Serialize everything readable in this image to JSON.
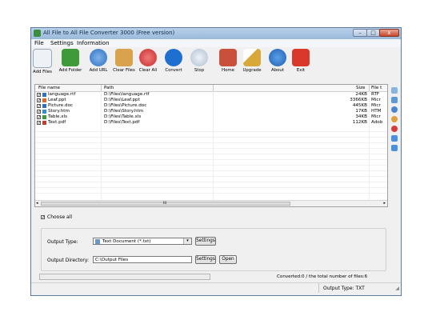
{
  "window": {
    "title": "All File to All File Converter 3000 (Free version)"
  },
  "menu": [
    "File",
    "Settings",
    "Information"
  ],
  "toolbar": [
    {
      "label": "Add Files",
      "icon": "add-files-icon",
      "color": "#e8eef4"
    },
    {
      "label": "Add Folder",
      "icon": "add-folder-icon",
      "color": "#3f9a3a"
    },
    {
      "label": "Add URL",
      "icon": "globe-icon",
      "color": "#2f6fc4"
    },
    {
      "label": "Clear Files",
      "icon": "clear-files-icon",
      "color": "#d9a24c"
    },
    {
      "label": "Clear All",
      "icon": "clear-all-icon",
      "color": "#d93a3a"
    },
    {
      "label": "Convert",
      "icon": "convert-icon",
      "color": "#1f6fd0"
    },
    {
      "label": "Stop",
      "icon": "stop-icon",
      "color": "#b9c9d9"
    },
    {
      "label": "Home",
      "icon": "home-icon",
      "color": "#c9503a"
    },
    {
      "label": "Upgrade",
      "icon": "upgrade-wand-icon",
      "color": "#d9a83a"
    },
    {
      "label": "About",
      "icon": "about-info-icon",
      "color": "#1f6fd0"
    },
    {
      "label": "Exit",
      "icon": "exit-power-icon",
      "color": "#d9382a"
    }
  ],
  "file_list": {
    "headers": {
      "name": "File name",
      "path": "Path",
      "size": "Size",
      "type": "File t"
    },
    "rows": [
      {
        "name": "language.rtf",
        "path": "D:\\Files\\language.rtf",
        "size": "24KB",
        "type": "RTF",
        "icon_color": "#2f6fc4"
      },
      {
        "name": "Leaf.ppt",
        "path": "D:\\Files\\Leaf.ppt",
        "size": "3366KB",
        "type": "Micr",
        "icon_color": "#d9682a"
      },
      {
        "name": "Picture.doc",
        "path": "D:\\Files\\Picture.doc",
        "size": "445KB",
        "type": "Micr",
        "icon_color": "#2f6fc4"
      },
      {
        "name": "Story.htm",
        "path": "D:\\Files\\Story.htm",
        "size": "17KB",
        "type": "HTM",
        "icon_color": "#2f8fd0"
      },
      {
        "name": "Table.xls",
        "path": "D:\\Files\\Table.xls",
        "size": "34KB",
        "type": "Micr",
        "icon_color": "#3f9a3a"
      },
      {
        "name": "Text.pdf",
        "path": "D:\\Files\\Text.pdf",
        "size": "112KB",
        "type": "Adob",
        "icon_color": "#c93a2a"
      }
    ],
    "scroll_center": "III"
  },
  "choose_all": {
    "label": "Choose all",
    "checked": true
  },
  "output": {
    "type_label": "Output Type:",
    "type_value": "Text Document (*.txt)",
    "settings_label": "Settings",
    "dir_label": "Output Directory:",
    "dir_value": "C:\\Output Files",
    "dir_settings_label": "Settings",
    "open_label": "Open"
  },
  "status": {
    "converted": "Converted:0  /  the total number of files:6",
    "output_type": "Output Type: TXT"
  },
  "colors": {
    "accent": "#1f6fd0",
    "titlebar": "#b9d1ea"
  }
}
